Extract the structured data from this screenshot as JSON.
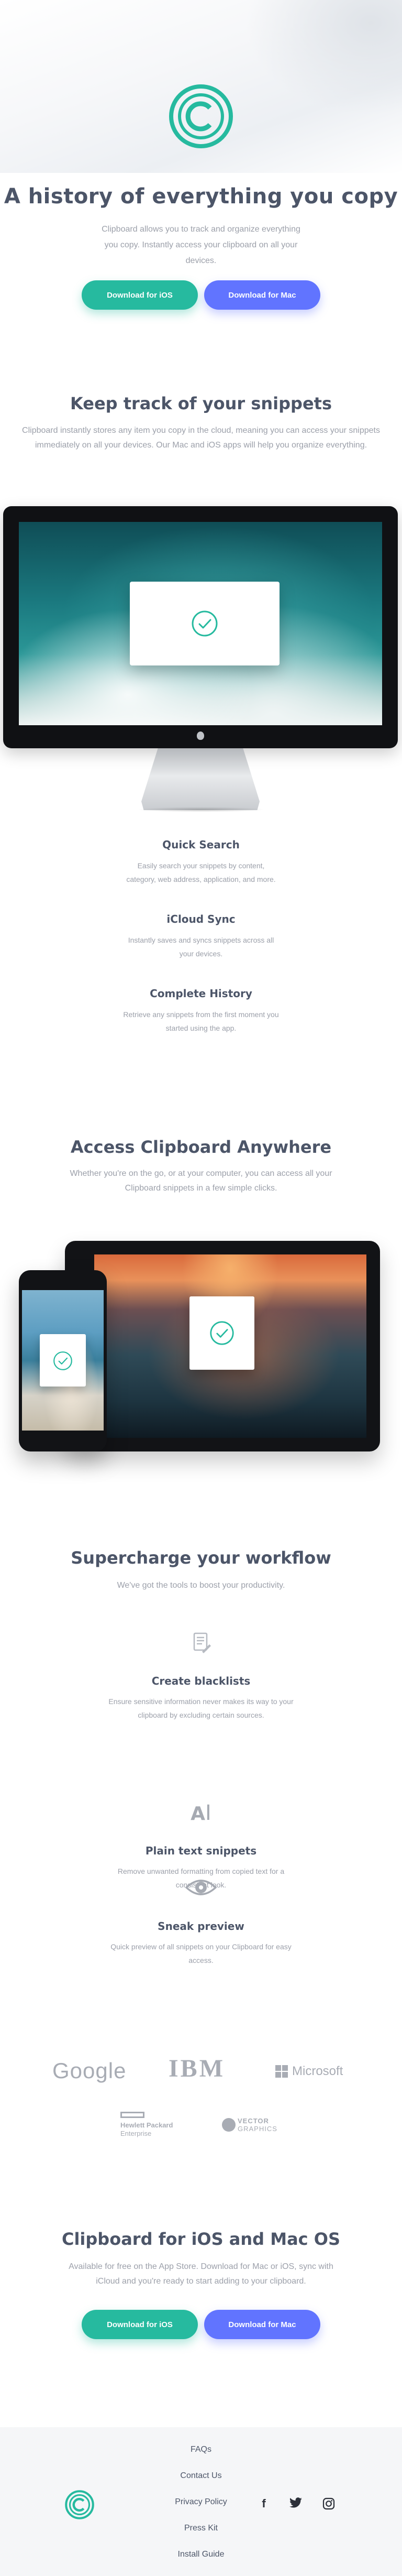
{
  "hero": {
    "title": "A history of everything you copy",
    "subtitle": "Clipboard allows you to track and organize everything you copy. Instantly access your clipboard on all your devices.",
    "ios_button": "Download for iOS",
    "mac_button": "Download for Mac"
  },
  "snippets": {
    "title": "Keep track of your snippets",
    "subtitle": "Clipboard instantly stores any item you copy in the cloud, meaning you can access your snippets immediately on all your devices. Our Mac and iOS apps will help you organize everything.",
    "features": [
      {
        "title": "Quick Search",
        "text": "Easily search your snippets by content, category, web address, application, and more."
      },
      {
        "title": "iCloud Sync",
        "text": "Instantly saves and syncs snippets across all your devices."
      },
      {
        "title": "Complete History",
        "text": "Retrieve any snippets from the first moment you started using the app."
      }
    ]
  },
  "access": {
    "title": "Access Clipboard Anywhere",
    "subtitle": "Whether you're on the go, or at your computer, you can access all your Clipboard snippets in a few simple clicks."
  },
  "workflow": {
    "title": "Supercharge your workflow",
    "subtitle": "We've got the tools to boost your productivity.",
    "items": [
      {
        "icon": "blacklist-icon",
        "title": "Create blacklists",
        "text": "Ensure sensitive information never makes its way to your clipboard by excluding certain sources."
      },
      {
        "icon": "text-cursor-icon",
        "title": "Plain text snippets",
        "text": "Remove unwanted formatting from copied text for a consistent look."
      },
      {
        "icon": "eye-icon",
        "title": "Sneak preview",
        "text": "Quick preview of all snippets on your Clipboard for easy access."
      }
    ]
  },
  "partners": {
    "google": "Google",
    "ibm": "IBM",
    "microsoft": "Microsoft",
    "hp_line1": "Hewlett Packard",
    "hp_line2": "Enterprise",
    "vector_line1": "VECTOR",
    "vector_line2": "GRAPHICS"
  },
  "cta": {
    "title": "Clipboard for iOS and Mac OS",
    "subtitle": "Available for free on the App Store. Download for Mac or iOS, sync with iCloud and you're ready to start adding to your clipboard.",
    "ios_button": "Download for iOS",
    "mac_button": "Download for Mac"
  },
  "footer": {
    "links": [
      "FAQs",
      "Contact Us",
      "Privacy Policy",
      "Press Kit",
      "Install Guide"
    ],
    "social": [
      {
        "icon": "facebook-icon",
        "glyph": "f"
      },
      {
        "icon": "twitter-icon",
        "glyph": "🐦"
      },
      {
        "icon": "instagram-icon",
        "glyph": "◎"
      }
    ]
  },
  "colors": {
    "accent": "#26ba9f",
    "secondary": "#6174ff",
    "heading": "#4c5568",
    "body": "#9ca0aa"
  }
}
